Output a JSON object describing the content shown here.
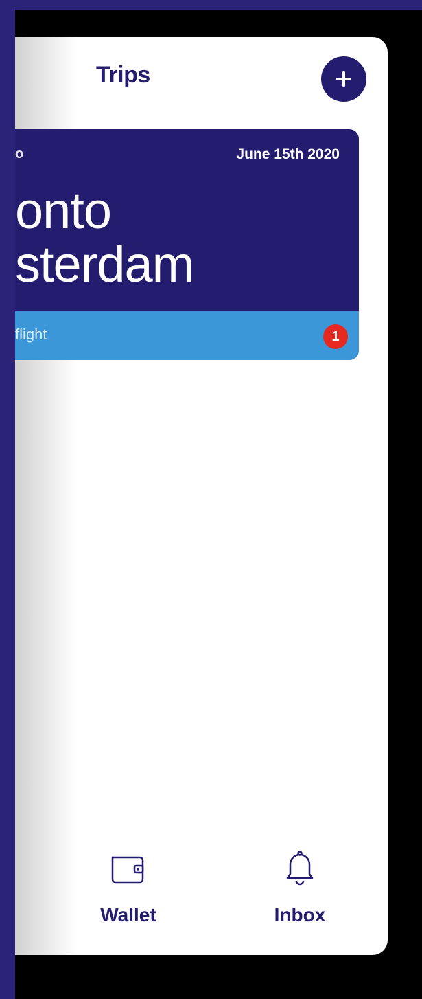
{
  "header": {
    "title": "Trips",
    "add_icon": "plus-icon"
  },
  "trip": {
    "code": "o",
    "date": "June 15th 2020",
    "route_line1": "onto",
    "route_line2": "sterdam",
    "footer_label": "flight",
    "badge_count": "1"
  },
  "tabs": [
    {
      "label": "Wallet",
      "icon": "wallet-icon"
    },
    {
      "label": "Inbox",
      "icon": "bell-icon"
    }
  ],
  "colors": {
    "primary": "#241c6e",
    "background_band": "#2a2377",
    "card_footer": "#3b97d8",
    "badge": "#e52920"
  }
}
